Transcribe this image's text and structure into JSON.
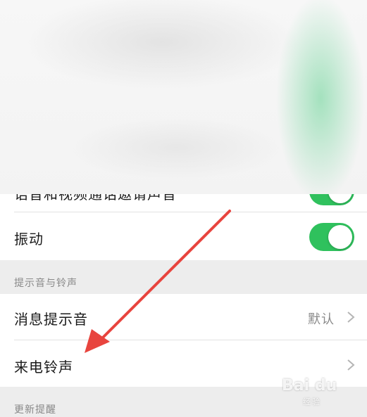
{
  "settings": {
    "partial_top_row": {
      "label": "语音和视频通话邀请声音"
    },
    "vibrate": {
      "label": "振动",
      "enabled": true
    },
    "section_sounds": {
      "header": "提示音与铃声"
    },
    "message_tone": {
      "label": "消息提示音",
      "value": "默认"
    },
    "ringtone": {
      "label": "来电铃声"
    },
    "section_updates": {
      "header": "更新提醒"
    }
  },
  "watermark": {
    "brand": "Bai du",
    "sub": "经验"
  },
  "colors": {
    "toggle_on": "#2fc15d",
    "annotation_arrow": "#e8443e"
  }
}
